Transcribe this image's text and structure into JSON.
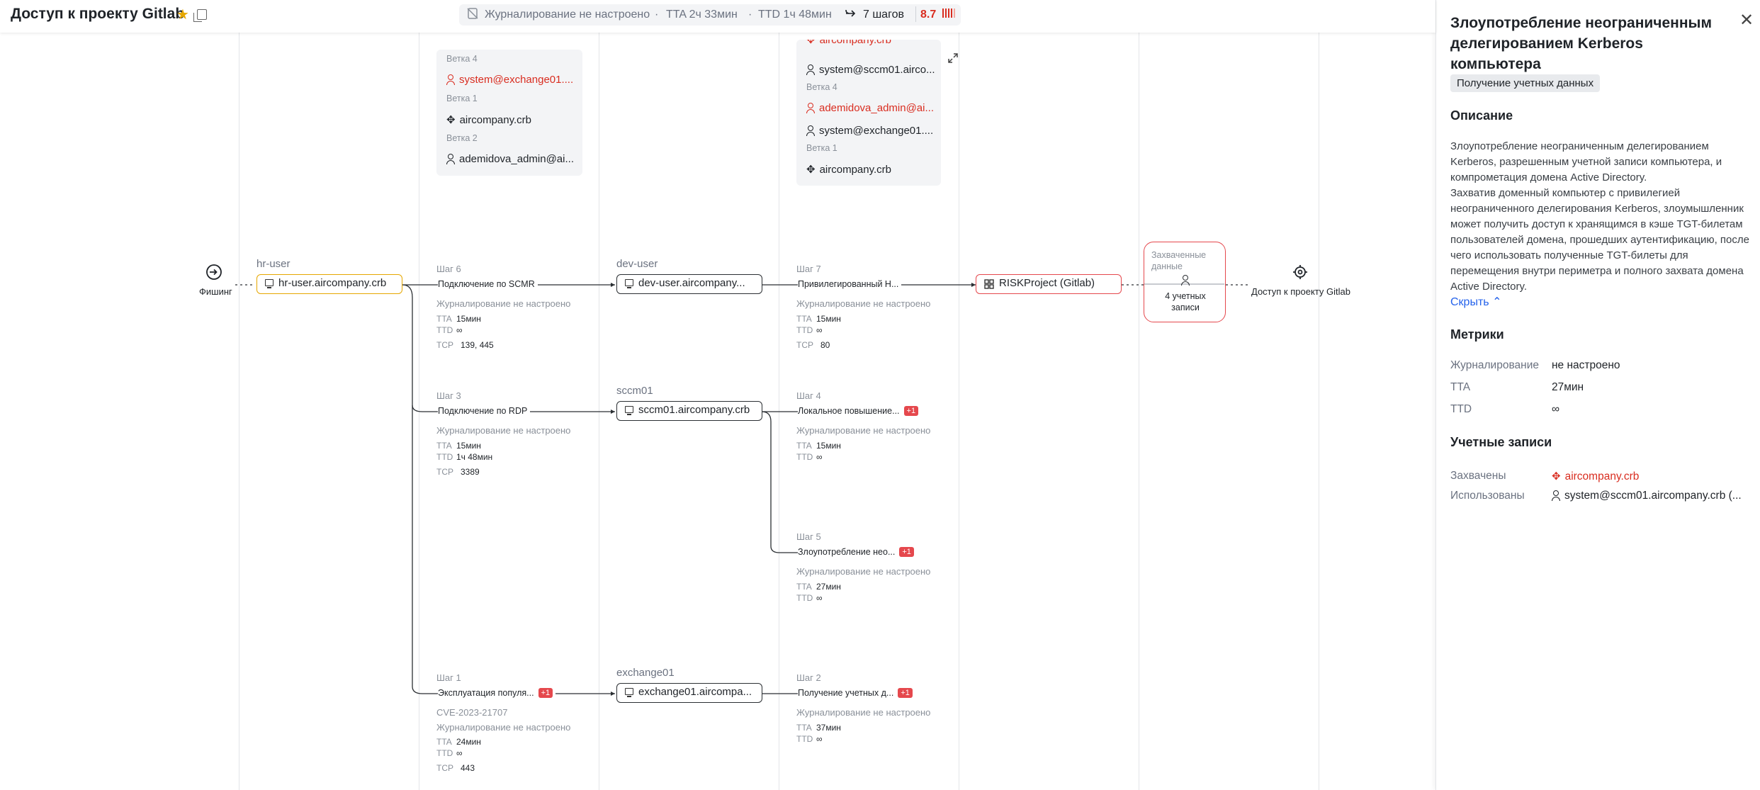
{
  "header": {
    "title": "Доступ к проекту Gitlab",
    "logging": "Журналирование не настроено",
    "tta": "TTA 2ч 33мин",
    "ttd": "TTD 1ч 48мин",
    "steps": "7 шагов",
    "score": "8.7",
    "colors": {
      "accent": "#d92d20",
      "star": "#e6a700"
    }
  },
  "graph": {
    "start": {
      "label": "Фишинг",
      "icon": "login-icon"
    },
    "target": {
      "label": "Доступ к проекту Gitlab",
      "icon": "target-icon"
    },
    "hosts": {
      "hr_user": {
        "label": "hr-user",
        "name": "hr-user.aircompany.crb"
      },
      "dev_user": {
        "label": "dev-user",
        "name": "dev-user.aircompany..."
      },
      "sccm01": {
        "label": "sccm01",
        "name": "sccm01.aircompany.crb"
      },
      "exchange01": {
        "label": "exchange01",
        "name": "exchange01.aircompa..."
      },
      "risk": {
        "name": "RISKProject (Gitlab)"
      }
    },
    "captured": {
      "title": "Захваченные данные",
      "count": "4 учетных записи"
    },
    "logging_na": "Журналирование не настроено",
    "steps": {
      "s6": {
        "num": "Шаг 6",
        "title": "Подключение по SCMR",
        "tta": "15мин",
        "ttd": "∞",
        "tcp": "139, 445"
      },
      "s3": {
        "num": "Шаг 3",
        "title": "Подключение по RDP",
        "tta": "15мин",
        "ttd": "1ч 48мин",
        "tcp": "3389"
      },
      "s1": {
        "num": "Шаг 1",
        "title": "Эксплуатация популя...",
        "badge": "+1",
        "cve": "CVE-2023-21707",
        "tta": "24мин",
        "ttd": "∞",
        "tcp": "443"
      },
      "s7": {
        "num": "Шаг 7",
        "title": "Привилегированный Н...",
        "tta": "15мин",
        "ttd": "∞",
        "tcp": "80"
      },
      "s4": {
        "num": "Шаг 4",
        "title": "Локальное повышение...",
        "badge": "+1",
        "tta": "15мин",
        "ttd": "∞"
      },
      "s5": {
        "num": "Шаг 5",
        "title": "Злоупотребление нео...",
        "badge": "+1",
        "tta": "27мин",
        "ttd": "∞"
      },
      "s2": {
        "num": "Шаг 2",
        "title": "Получение учетных д...",
        "badge": "+1",
        "tta": "37мин",
        "ttd": "∞"
      }
    },
    "metric_labels": {
      "tta": "TTA",
      "ttd": "TTD",
      "tcp": "TCP"
    },
    "card_left": {
      "b4": "Ветка 4",
      "i1": "system@exchange01....",
      "b1": "Ветка 1",
      "i2": "aircompany.crb",
      "b2": "Ветка 2",
      "i3": "ademidova_admin@ai..."
    },
    "card_right": {
      "i0": "aircompany.crb",
      "i1": "system@sccm01.airco...",
      "b4": "Ветка 4",
      "i2": "ademidova_admin@ai...",
      "i3": "system@exchange01....",
      "b1": "Ветка 1",
      "i4": "aircompany.crb"
    }
  },
  "panel": {
    "title": "Злоупотребление неограниченным делегированием Kerberos компьютера",
    "tag": "Получение учетных данных",
    "description_heading": "Описание",
    "description": "Злоупотребление неограниченным делегированием Kerberos, разрешенным учетной записи компьютера, и компрометация домена Active Directory.\nЗахватив доменный компьютер с привилегией неограниченного делегирования Kerberos, злоумышленник может получить доступ к хранящимся в кэше TGT-билетам пользователей домена, прошедших аутентификацию, после чего использовать полученные TGT-билеты для перемещения внутри периметра и полного захвата домена Active Directory.",
    "hide": "Скрыть",
    "metrics_heading": "Метрики",
    "metrics": [
      {
        "k": "Журналирование",
        "v": "не настроено"
      },
      {
        "k": "TTA",
        "v": "27мин"
      },
      {
        "k": "TTD",
        "v": "∞"
      }
    ],
    "accounts_heading": "Учетные записи",
    "captured_label": "Захвачены",
    "captured_value": "aircompany.crb",
    "used_label": "Использованы",
    "used_value": "system@sccm01.aircompany.crb (..."
  }
}
